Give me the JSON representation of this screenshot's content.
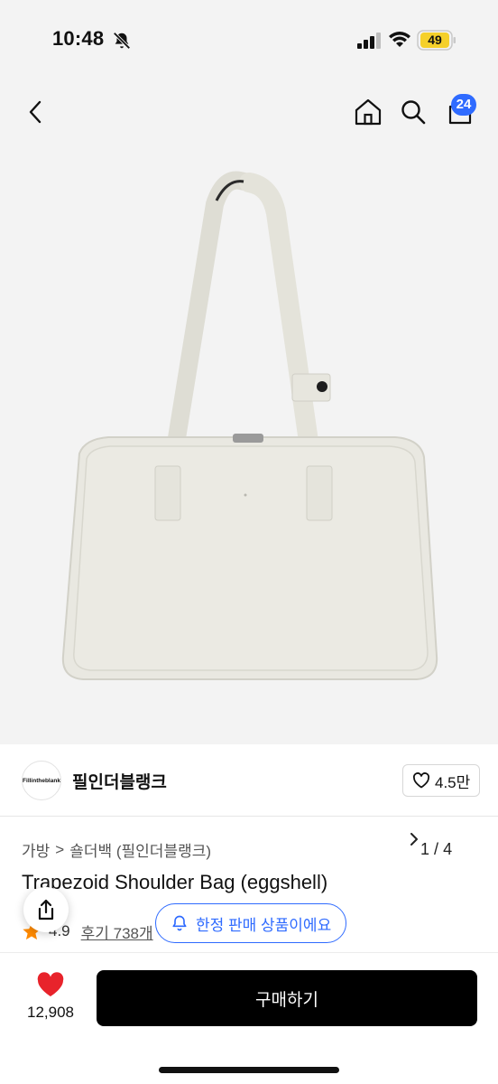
{
  "status_bar": {
    "time": "10:48",
    "battery": "49",
    "icons": [
      "bell-slash-icon",
      "signal-icon",
      "wifi-icon",
      "battery-icon"
    ]
  },
  "nav": {
    "icons": [
      "back-chevron-icon",
      "home-icon",
      "search-icon",
      "cart-icon"
    ],
    "cart_count": "24"
  },
  "gallery": {
    "current": "1",
    "total": "4",
    "separator": "/"
  },
  "brand": {
    "logo_text": "Fillintheblank",
    "name": "필인더블랭크",
    "likes": "4.5만"
  },
  "breadcrumb": {
    "items": [
      "가방",
      "숄더백 (필인더블랭크)"
    ],
    "separator": ">"
  },
  "product": {
    "title": "Trapezoid Shoulder Bag (eggshell)",
    "rating": "4.9",
    "reviews_label": "후기 738개",
    "limited_label": "한정 판매 상품이에요"
  },
  "bottom_bar": {
    "wish_count": "12,908",
    "buy_label": "구매하기"
  },
  "colors": {
    "accent_blue": "#2f6bff",
    "heart_red": "#e8232b",
    "star_orange": "#ff8a00",
    "buy_bg": "#000000"
  }
}
